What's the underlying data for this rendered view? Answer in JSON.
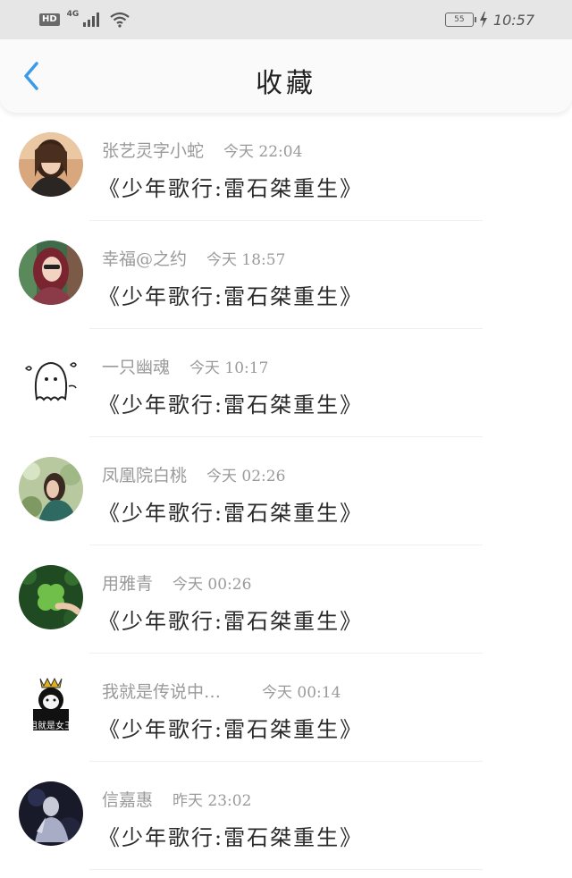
{
  "status_bar": {
    "hd_label": "HD",
    "network_label": "4G",
    "battery_level": "55",
    "time": "10:57"
  },
  "nav": {
    "title": "收藏",
    "back_icon": "chevron-left-icon",
    "accent_color": "#3a9be8"
  },
  "favorites": [
    {
      "name": "张艺灵字小蛇",
      "time": "今天 22:04",
      "title": "《少年歌行:雷石桀重生》"
    },
    {
      "name": "幸福@之约",
      "time": "今天 18:57",
      "title": "《少年歌行:雷石桀重生》"
    },
    {
      "name": "一只幽魂",
      "time": "今天 10:17",
      "title": "《少年歌行:雷石桀重生》"
    },
    {
      "name": "凤凰院白桃",
      "time": "今天 02:26",
      "title": "《少年歌行:雷石桀重生》"
    },
    {
      "name": "用雅青",
      "time": "今天 00:26",
      "title": "《少年歌行:雷石桀重生》"
    },
    {
      "name": "我就是传说中…",
      "time": "今天 00:14",
      "title": "《少年歌行:雷石桀重生》",
      "avatar_text": "姐就是女王"
    },
    {
      "name": "信嘉惠",
      "time": "昨天 23:02",
      "title": "《少年歌行:雷石桀重生》"
    }
  ]
}
